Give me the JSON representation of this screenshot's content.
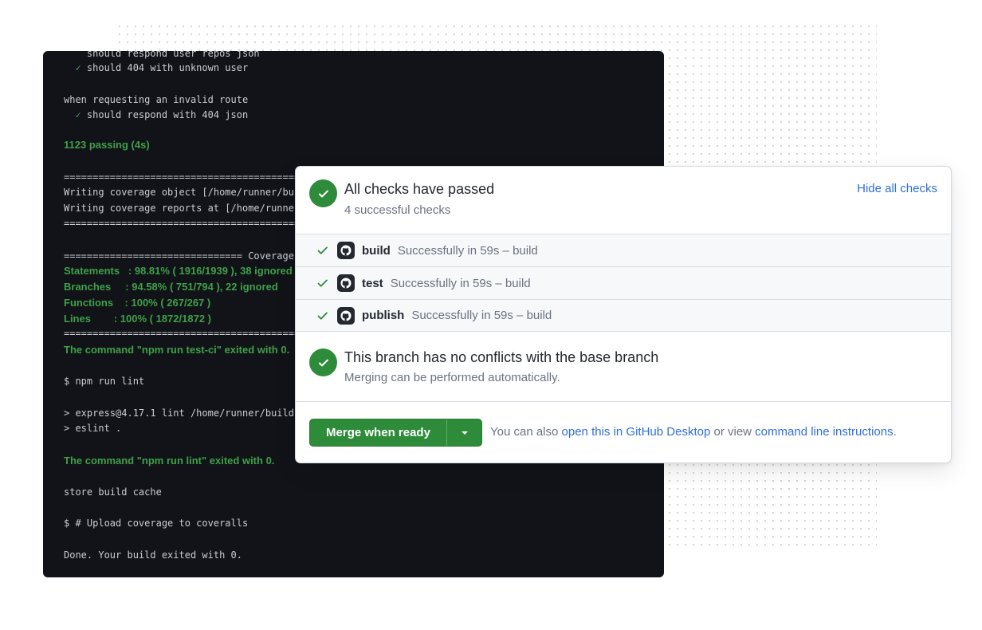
{
  "terminal": {
    "lines": [
      {
        "text": "    should respond user repos json",
        "green": false
      },
      {
        "text": "  ✓ should 404 with unknown user",
        "green": false
      },
      {
        "text": "when requesting an invalid route",
        "green": false
      },
      {
        "text": "  ✓ should respond with 404 json",
        "green": false
      },
      {
        "text": "1123 passing (4s)",
        "green": true
      },
      {
        "text": "=========================================================================",
        "green": false
      },
      {
        "text": "Writing coverage object [/home/runner/build/coverage/coverage.json]",
        "green": false
      },
      {
        "text": "Writing coverage reports at [/home/runner/build/coverage]",
        "green": false
      },
      {
        "text": "=========================================================================",
        "green": false
      },
      {
        "text": "=============================== Coverage summary ===============================",
        "green": false
      },
      {
        "text": "Statements   : 98.81% ( 1916/1939 ), 38 ignored",
        "green": true
      },
      {
        "text": "Branches     : 94.58% ( 751/794 ), 22 ignored",
        "green": true
      },
      {
        "text": "Functions    : 100% ( 267/267 )",
        "green": true
      },
      {
        "text": "Lines        : 100% ( 1872/1872 )",
        "green": true
      },
      {
        "text": "================================================================================",
        "green": false
      },
      {
        "text": "The command \"npm run test-ci\" exited with 0.",
        "green": true
      },
      {
        "text": "$ npm run lint",
        "green": false
      },
      {
        "text": "> express@4.17.1 lint /home/runner/build",
        "green": false
      },
      {
        "text": "> eslint .",
        "green": false
      },
      {
        "text": "The command \"npm run lint\" exited with 0.",
        "green": true
      },
      {
        "text": "store build cache",
        "green": false
      },
      {
        "text": "$ # Upload coverage to coveralls",
        "green": false
      },
      {
        "text": "Done. Your build exited with 0.",
        "green": false
      }
    ]
  },
  "checks_panel": {
    "title": "All checks have passed",
    "subtitle": "4 successful checks",
    "hide_link": "Hide all checks",
    "checks": [
      {
        "name": "build",
        "description": "Successfully in 59s – build"
      },
      {
        "name": "test",
        "description": "Successfully in 59s – build"
      },
      {
        "name": "publish",
        "description": "Successfully in 59s – build"
      }
    ]
  },
  "branch_status": {
    "title": "This branch has no conflicts with the base branch",
    "subtitle": "Merging can be performed automatically."
  },
  "merge": {
    "button_label": "Merge when ready",
    "text_before": "You can also ",
    "desktop_link": "open this in GitHub Desktop",
    "text_middle": " or view ",
    "cli_link": "command line instructions",
    "text_after": "."
  },
  "colors": {
    "success": "#2e8b3a",
    "link": "#2f6fdb",
    "terminal_bg": "#111318"
  },
  "icons": [
    "check-icon",
    "github-icon",
    "caret-down-icon"
  ]
}
